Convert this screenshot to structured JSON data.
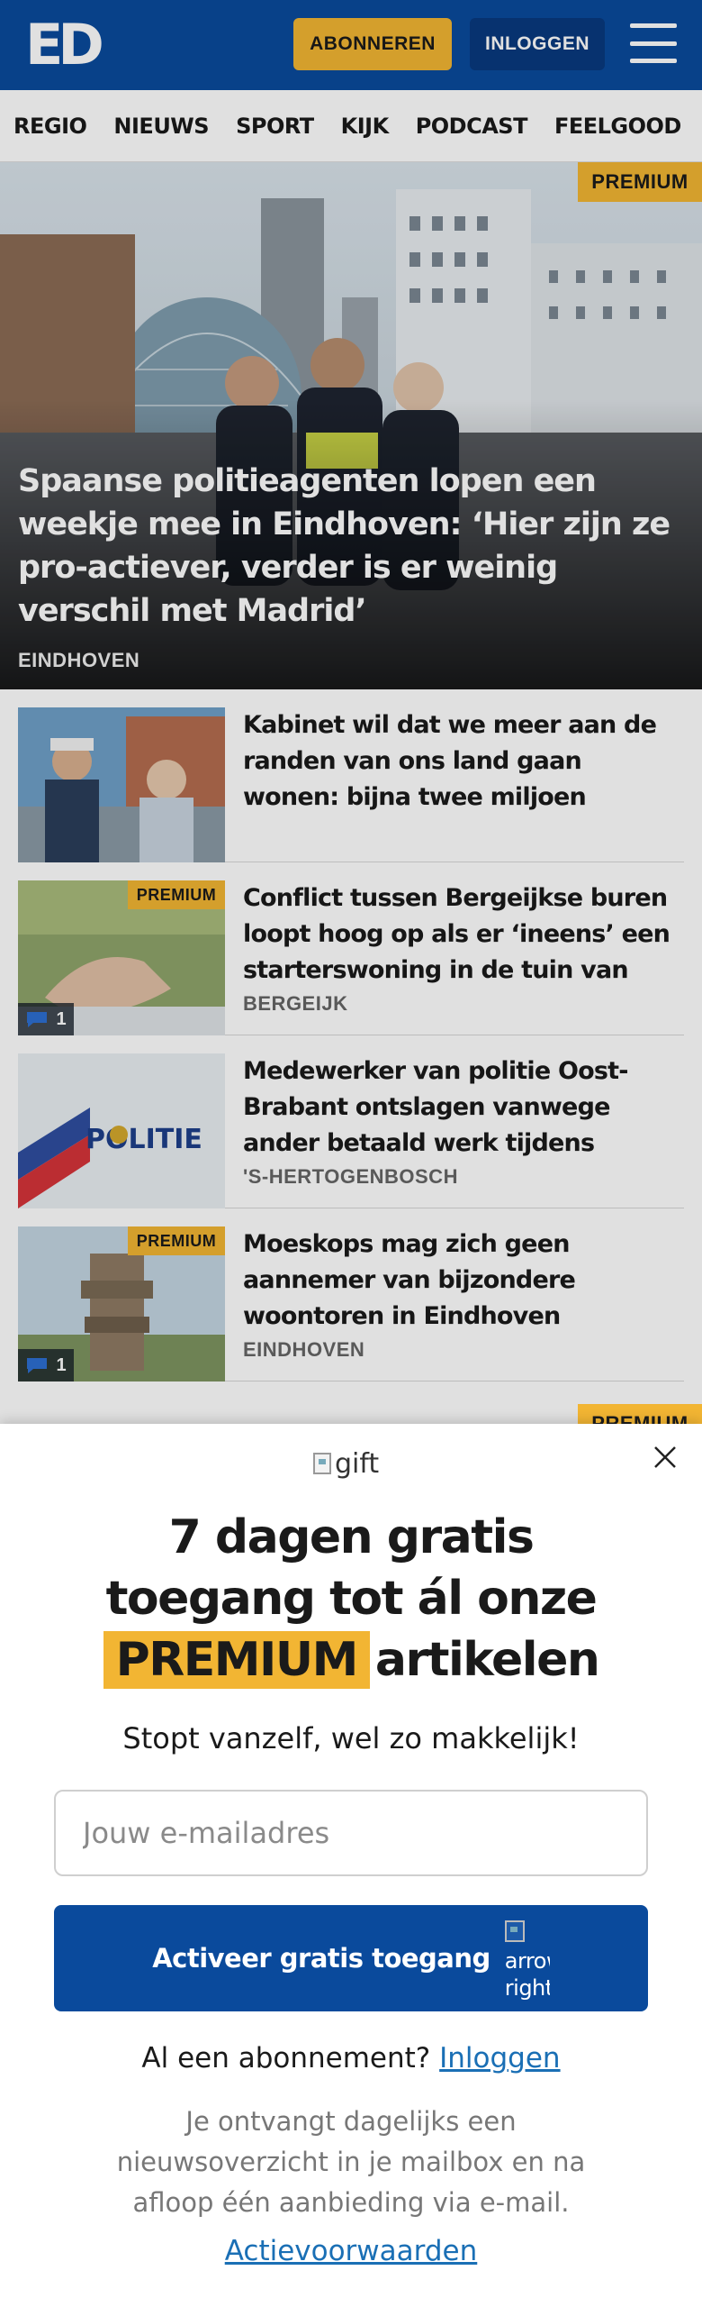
{
  "header": {
    "logo": "ED",
    "subscribe_label": "ABONNEREN",
    "login_label": "INLOGGEN",
    "menu_icon": "hamburger-menu-icon",
    "brand_color": "#0a4a9c"
  },
  "nav": {
    "items": [
      "REGIO",
      "NIEUWS",
      "SPORT",
      "KIJK",
      "PODCAST",
      "FEELGOOD"
    ]
  },
  "hero": {
    "badge": "PREMIUM",
    "title": "Spaanse politieagenten lopen een weekje mee in Eindhoven: ‘Hier zijn ze pro-actiever, verder is er weinig verschil met Madrid’",
    "region": "EINDHOVEN"
  },
  "articles": [
    {
      "title": "Kabinet wil dat we meer aan de randen van ons land gaan wonen: bijna twee miljoen nieuwe huize…",
      "region": "",
      "badge": "",
      "comments": ""
    },
    {
      "title": "Conflict tussen Bergeijkse buren loopt hoog op als er ‘ineens’ een starterswoning in de tuin van d…",
      "region": "BERGEIJK",
      "badge": "PREMIUM",
      "comments": "1"
    },
    {
      "title": "Medewerker van politie Oost-Brabant ontslagen vanwege ander betaald werk tijdens dienst",
      "region": "'S-HERTOGENBOSCH",
      "badge": "",
      "comments": ""
    },
    {
      "title": "Moeskops mag zich geen aannemer van bijzondere woontoren in Eindhoven noeme…",
      "region": "EINDHOVEN",
      "badge": "PREMIUM",
      "comments": "1"
    }
  ],
  "next_badge": "PREMIUM",
  "popup": {
    "gift_alt": "gift",
    "headline_line1": "7 dagen gratis",
    "headline_line2": "toegang tot ál onze",
    "headline_badge": "PREMIUM",
    "headline_tail": "artikelen",
    "subline": "Stopt vanzelf, wel zo makkelijk!",
    "email_placeholder": "Jouw e-mailadres",
    "activate_label": "Activeer gratis toegang",
    "arrow_alt": "arrow right",
    "already_text": "Al een abonnement?",
    "already_link": "Inloggen",
    "info": "Je ontvangt dagelijks een nieuwsoverzicht in je mailbox en na afloop één aanbieding via e-mail.",
    "terms": "Actievoorwaarden",
    "premium_color": "#f2b533"
  }
}
